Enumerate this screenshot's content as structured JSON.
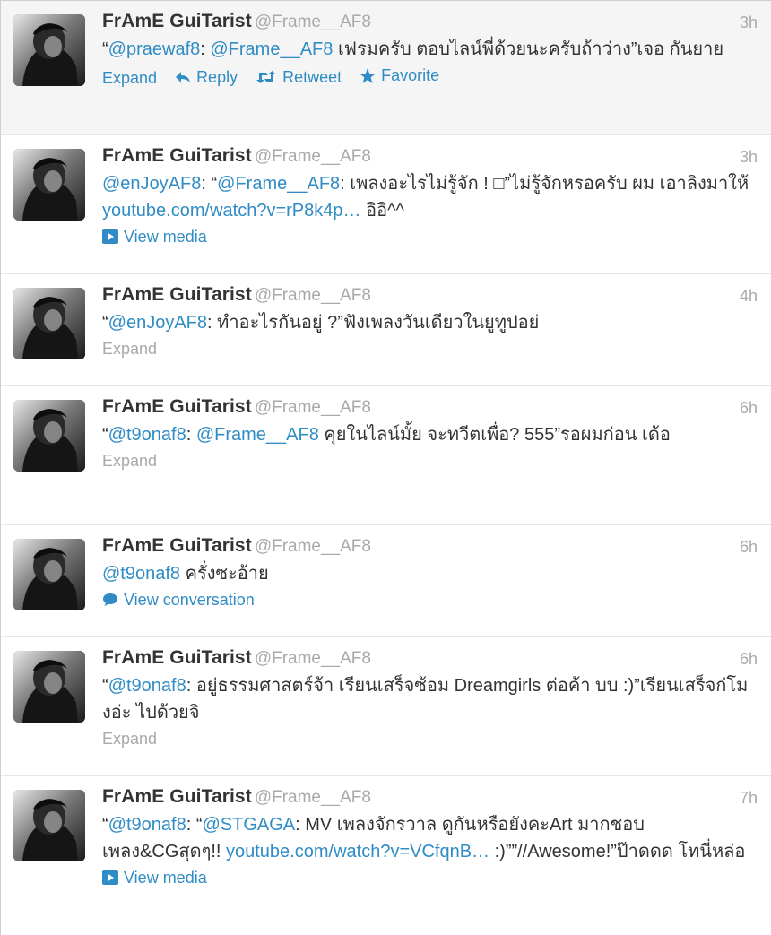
{
  "tweets": [
    {
      "name": "FrAmE GuiTarist",
      "handle": "@Frame__AF8",
      "time": "3h",
      "parts": [
        {
          "t": "“",
          "link": false
        },
        {
          "t": "@praewaf8",
          "link": true
        },
        {
          "t": ": ",
          "link": false
        },
        {
          "t": "@Frame__AF8",
          "link": true
        },
        {
          "t": " เฟรมครับ ตอบไลน์พี่ด้วยนะครับถ้าว่าง”เจอ กันยาย",
          "link": false
        }
      ],
      "actions": {
        "expand": "Expand",
        "reply": "Reply",
        "retweet": "Retweet",
        "favorite": "Favorite"
      }
    },
    {
      "name": "FrAmE GuiTarist",
      "handle": "@Frame__AF8",
      "time": "3h",
      "parts": [
        {
          "t": "@enJoyAF8",
          "link": true
        },
        {
          "t": ": “",
          "link": false
        },
        {
          "t": "@Frame__AF8",
          "link": true
        },
        {
          "t": ": เพลงอะไรไม่รู้จัก ! □”ไม่รู้จักหรอครับ ผม เอาลิงมาให้ ",
          "link": false
        },
        {
          "t": "youtube.com/watch?v=rP8k4p…",
          "link": true
        },
        {
          "t": " อิอิ^^",
          "link": false
        }
      ],
      "footer": {
        "kind": "media",
        "label": "View media"
      }
    },
    {
      "name": "FrAmE GuiTarist",
      "handle": "@Frame__AF8",
      "time": "4h",
      "parts": [
        {
          "t": "“",
          "link": false
        },
        {
          "t": "@enJoyAF8",
          "link": true
        },
        {
          "t": ": ทำอะไรกันอยู่ ?”ฟังเพลงวันเดียวในยูทูปอย่",
          "link": false
        }
      ],
      "footer": {
        "kind": "expand",
        "label": "Expand"
      }
    },
    {
      "name": "FrAmE GuiTarist",
      "handle": "@Frame__AF8",
      "time": "6h",
      "parts": [
        {
          "t": "“",
          "link": false
        },
        {
          "t": "@t9onaf8",
          "link": true
        },
        {
          "t": ": ",
          "link": false
        },
        {
          "t": "@Frame__AF8",
          "link": true
        },
        {
          "t": " คุยในไลน์มั้ย จะทวีตเพื่อ? 555”รอผมก่อน เด้อ",
          "link": false
        }
      ],
      "footer": {
        "kind": "expand",
        "label": "Expand"
      }
    },
    {
      "name": "FrAmE GuiTarist",
      "handle": "@Frame__AF8",
      "time": "6h",
      "parts": [
        {
          "t": "@t9onaf8",
          "link": true
        },
        {
          "t": " ครั่งซะอ้าย",
          "link": false
        }
      ],
      "footer": {
        "kind": "conversation",
        "label": "View conversation"
      }
    },
    {
      "name": "FrAmE GuiTarist",
      "handle": "@Frame__AF8",
      "time": "6h",
      "parts": [
        {
          "t": "“",
          "link": false
        },
        {
          "t": "@t9onaf8",
          "link": true
        },
        {
          "t": ": อยู่ธรรมศาสตร์จ้า เรียนเสร็จซ้อม Dreamgirls ต่อค้า บบ :)”เรียนเสร็จก่โมงอ่ะ ไปด้วยจิ",
          "link": false
        }
      ],
      "footer": {
        "kind": "expand",
        "label": "Expand"
      }
    },
    {
      "name": "FrAmE GuiTarist",
      "handle": "@Frame__AF8",
      "time": "7h",
      "parts": [
        {
          "t": "“",
          "link": false
        },
        {
          "t": "@t9onaf8",
          "link": true
        },
        {
          "t": ": “",
          "link": false
        },
        {
          "t": "@STGAGA",
          "link": true
        },
        {
          "t": ": MV เพลงจักรวาล ดูกันหรือยังคะArt มากชอบ เพลง&CGสุดๆ!! ",
          "link": false
        },
        {
          "t": "youtube.com/watch?v=VCfqnB…",
          "link": true
        },
        {
          "t": " :)””//Awesome!”ป๊าดดด โทนี่หล่อ",
          "link": false
        }
      ],
      "footer": {
        "kind": "media",
        "label": "View media"
      }
    }
  ],
  "colors": {
    "link": "#2f8cc5",
    "muted": "#a9a9a9",
    "text": "#333333",
    "hover_bg": "#f5f5f5"
  }
}
